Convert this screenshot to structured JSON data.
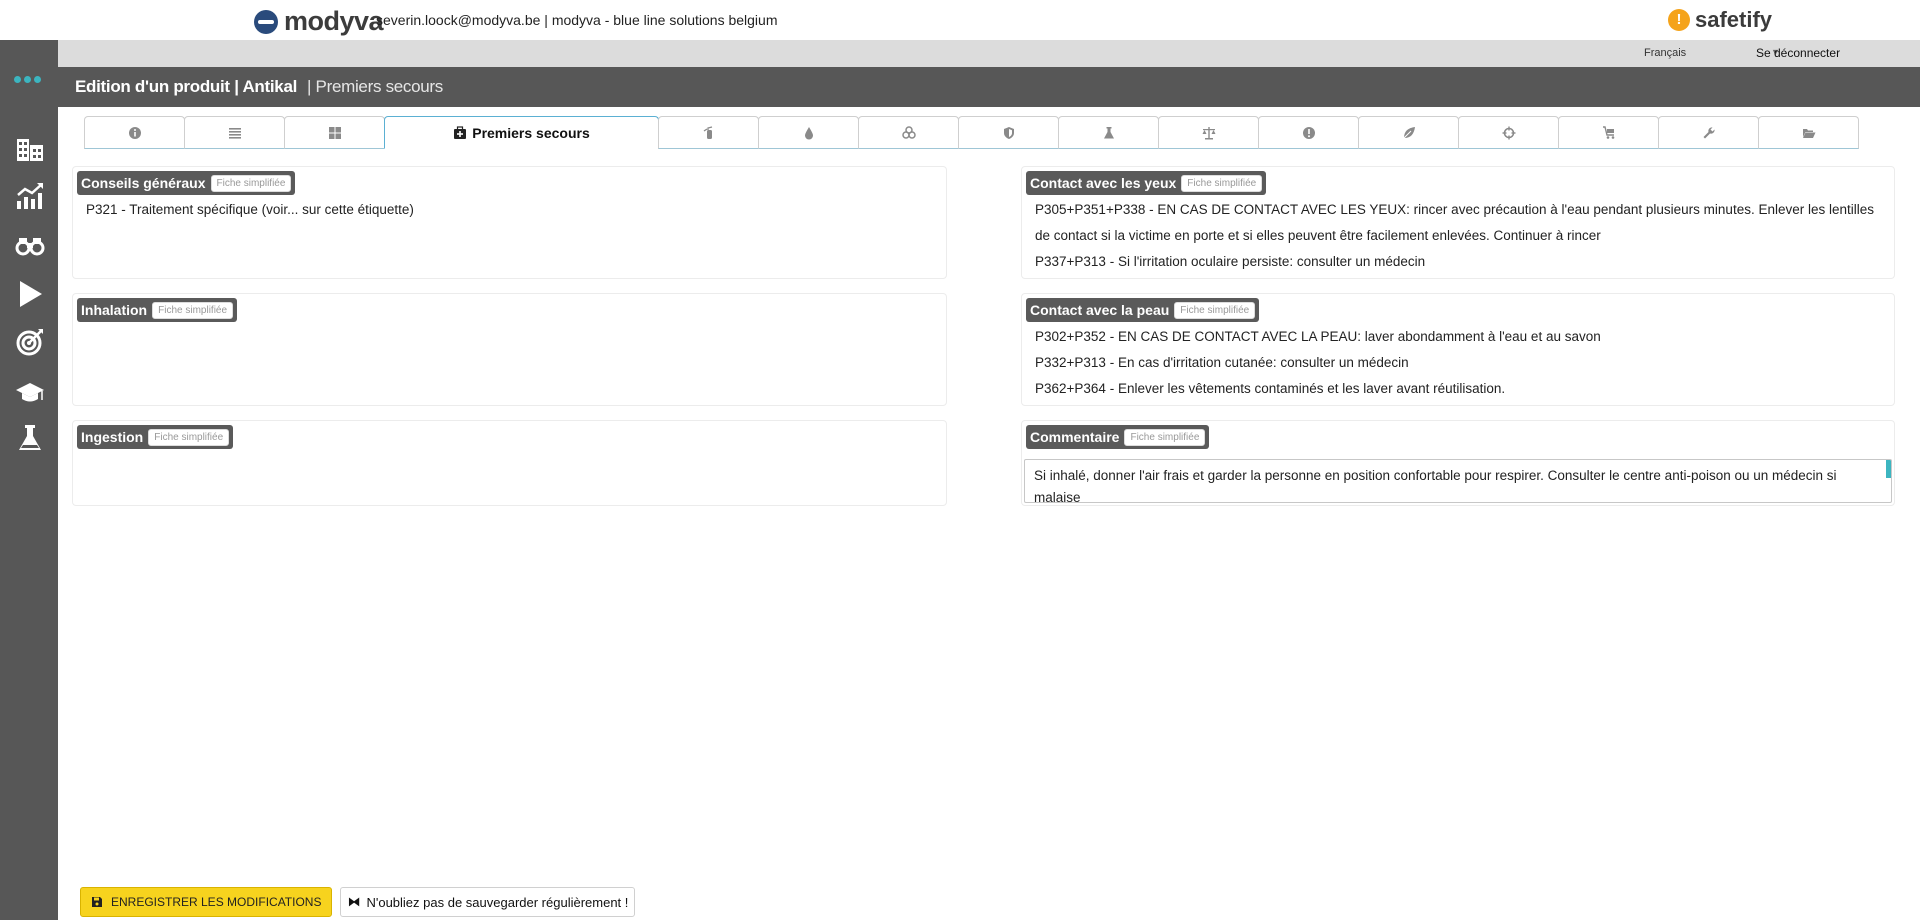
{
  "header": {
    "brand": "modyva",
    "user": "severin.loock@modyva.be | modyva - blue line solutions belgium",
    "partner_brand": "safetify",
    "language": "Français",
    "logout": "Se déconnecter"
  },
  "page": {
    "title": "Edition d'un produit | Antikal",
    "subtitle": "| Premiers secours"
  },
  "tabs": {
    "active_label": "Premiers secours",
    "icons": [
      "info-icon",
      "list-icon",
      "grid-icon",
      "first-aid-icon",
      "fire-extinguisher-icon",
      "drop-icon",
      "biohazard-icon",
      "shield-icon",
      "flask-icon",
      "scale-icon",
      "exclamation-icon",
      "leaf-icon",
      "crosshair-icon",
      "cart-icon",
      "wrench-icon",
      "folder-open-icon"
    ]
  },
  "badge": "Fiche simplifiée",
  "sections": {
    "general": {
      "title": "Conseils généraux",
      "phrases": [
        "P321 - Traitement spécifique (voir... sur cette étiquette)"
      ]
    },
    "inhalation": {
      "title": "Inhalation"
    },
    "ingestion": {
      "title": "Ingestion"
    },
    "eyes": {
      "title": "Contact avec les yeux",
      "phrases": [
        "P305+P351+P338 - EN CAS DE CONTACT AVEC LES YEUX: rincer avec précaution à  l'eau pendant plusieurs minutes. Enlever les lentilles de contact si la victime en porte et si elles peuvent être facilement enlevées. Continuer à  rincer",
        "P337+P313 - Si l'irritation oculaire persiste: consulter un médecin"
      ]
    },
    "skin": {
      "title": "Contact avec la peau",
      "phrases": [
        "P302+P352 - EN CAS DE CONTACT AVEC LA PEAU: laver abondamment à  l'eau et au savon",
        "P332+P313 - En cas d'irritation cutanée: consulter un médecin",
        "P362+P364 - Enlever les vêtements contaminés et les laver avant réutilisation."
      ]
    },
    "comment": {
      "title": "Commentaire",
      "value": "Si inhalé, donner l'air frais et garder la personne en position confortable pour respirer. Consulter le centre anti-poison ou un médecin si malaise"
    }
  },
  "footer": {
    "save_label": "ENREGISTRER LES MODIFICATIONS",
    "reminder": "N'oubliez pas de sauvegarder régulièrement !"
  },
  "colors": {
    "sidebar": "#575757",
    "accent": "#3cb5c0",
    "save_button": "#f7d31e",
    "safetify_orange": "#f5a31a"
  }
}
